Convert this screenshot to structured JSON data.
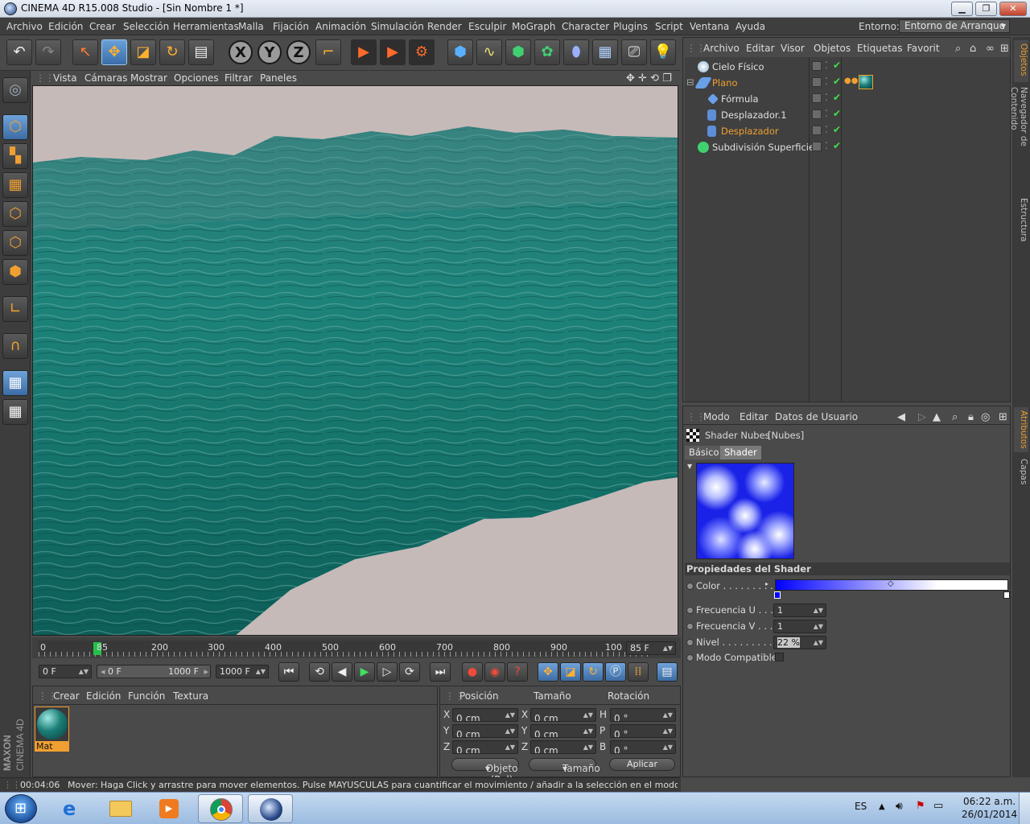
{
  "window": {
    "title": "CINEMA 4D R15.008 Studio - [Sin Nombre 1 *]",
    "min": "▁",
    "max": "❐",
    "close": "✕"
  },
  "menu": {
    "items": [
      "Archivo",
      "Edición",
      "Crear",
      "Selección",
      "Herramientas",
      "Malla",
      "Fijación",
      "Animación",
      "Simulación",
      "Render",
      "Esculpir",
      "MoGraph",
      "Character",
      "Plugins",
      "Script",
      "Ventana",
      "Ayuda"
    ],
    "layout_label": "Entorno:",
    "layout_value": "Entorno de Arranque"
  },
  "toolbar": {
    "x": "X",
    "y": "Y",
    "z": "Z"
  },
  "viewport": {
    "menu": [
      "Vista",
      "Cámaras",
      "Mostrar",
      "Opciones",
      "Filtrar",
      "Paneles"
    ]
  },
  "timeline": {
    "ticks": [
      "0",
      "85",
      "200",
      "300",
      "400",
      "500",
      "600",
      "700",
      "800",
      "900",
      "100"
    ],
    "current_frame": "85 F",
    "marker_frame": 85
  },
  "transport": {
    "start_field": "0 F",
    "range_start": "0 F",
    "range_end": "1000 F",
    "end_field": "1000 F"
  },
  "materials": {
    "menu": [
      "Crear",
      "Edición",
      "Función",
      "Textura"
    ],
    "items": [
      {
        "name": "Mat"
      }
    ]
  },
  "coords": {
    "headers": [
      "Posición",
      "Tamaño",
      "Rotación"
    ],
    "rows": [
      {
        "axis": "X",
        "pos": "0 cm",
        "size_axis": "X",
        "size": "0 cm",
        "rot_axis": "H",
        "rot": "0 °"
      },
      {
        "axis": "Y",
        "pos": "0 cm",
        "size_axis": "Y",
        "size": "0 cm",
        "rot_axis": "P",
        "rot": "0 °"
      },
      {
        "axis": "Z",
        "pos": "0 cm",
        "size_axis": "Z",
        "size": "0 cm",
        "rot_axis": "B",
        "rot": "0 °"
      }
    ],
    "mode": "Objeto (Rel)",
    "size_mode": "Tamaño",
    "apply": "Aplicar"
  },
  "status": {
    "time": "00:04:06",
    "message": "Mover: Haga Click y arrastre para mover elementos. Pulse MAYUSCULAS para cuantificar el movimiento / añadir a la selección en el modo punto. CTRL"
  },
  "objects": {
    "menu": [
      "Archivo",
      "Editar",
      "Visor",
      "Objetos",
      "Etiquetas",
      "Favorit"
    ],
    "rows": [
      {
        "name": "Cielo Físico",
        "selected": false
      },
      {
        "name": "Plano",
        "selected": true
      },
      {
        "name": "Fórmula",
        "selected": false
      },
      {
        "name": "Desplazador.1",
        "selected": false
      },
      {
        "name": "Desplazador",
        "selected": true
      },
      {
        "name": "Subdivisión Superficie",
        "selected": false
      }
    ]
  },
  "attributes": {
    "menu": [
      "Modo",
      "Editar",
      "Datos de Usuario"
    ],
    "shader_title": "Shader Nubes",
    "shader_sub": "[Nubes]",
    "tabs": [
      "Básico",
      "Shader"
    ],
    "section": "Propiedades del Shader",
    "props": [
      {
        "label": "Color . . . . . . . . .",
        "value": ""
      },
      {
        "label": "Frecuencia U . . . .",
        "value": "1"
      },
      {
        "label": "Frecuencia V . . . .",
        "value": "1"
      },
      {
        "label": "Nivel . . . . . . . . . . .",
        "value": "22 %"
      },
      {
        "label": "Modo Compatible",
        "value": ""
      }
    ]
  },
  "side_tabs": [
    "Objetos",
    "Navegador de Contenido",
    "Estructura",
    "Atributos",
    "Capas"
  ],
  "logo": {
    "line1": "MAXON",
    "line2": "CINEMA 4D"
  },
  "taskbar": {
    "lang": "ES",
    "time": "06:22 a.m.",
    "date": "26/01/2014"
  },
  "colors": {
    "accent": "#f0a030",
    "selected_text": "#f0a030",
    "water": "#1e7f78",
    "viewport_bg": "#c6bab9"
  }
}
